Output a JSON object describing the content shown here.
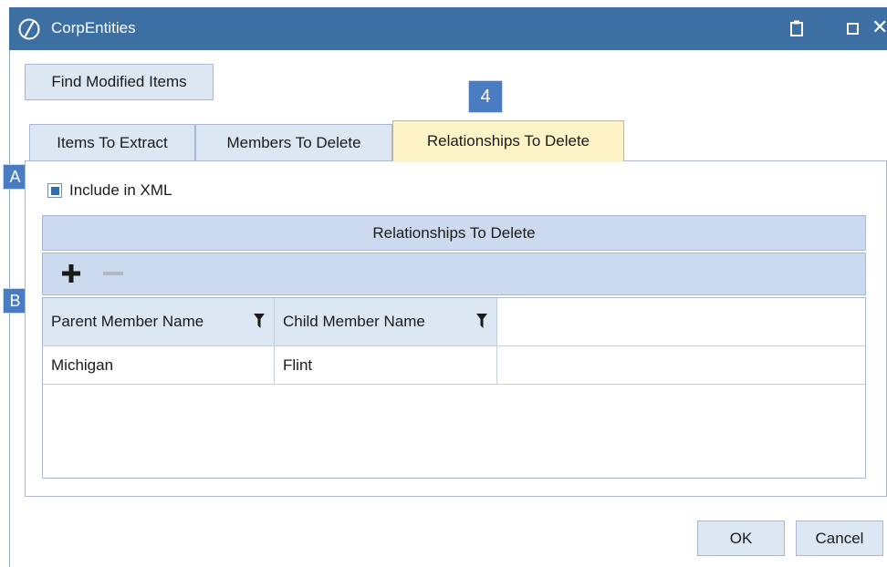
{
  "window": {
    "title": "CorpEntities",
    "icons": [
      "app-logo-icon",
      "clipboard-icon",
      "maximize-icon",
      "close-icon"
    ],
    "close_glyph": "✕"
  },
  "toolbar": {
    "find_label": "Find Modified Items"
  },
  "callouts": {
    "tab": "4",
    "a": "A",
    "b": "B"
  },
  "tabs": [
    {
      "label": "Items To Extract",
      "active": false
    },
    {
      "label": "Members To Delete",
      "active": false
    },
    {
      "label": "Relationships To Delete",
      "active": true
    }
  ],
  "panel": {
    "include_label": "Include in XML",
    "include_checked": true,
    "grid_title": "Relationships To Delete",
    "columns": [
      "Parent Member Name",
      "Child Member Name",
      ""
    ],
    "rows": [
      [
        "Michigan",
        "Flint",
        ""
      ]
    ]
  },
  "footer": {
    "ok_label": "OK",
    "cancel_label": "Cancel"
  },
  "colors": {
    "titlebar": "#3d6fa3",
    "active_tab": "#fdf3c6",
    "grid_header": "#ccdaf0",
    "callout": "#4a7cc4"
  }
}
